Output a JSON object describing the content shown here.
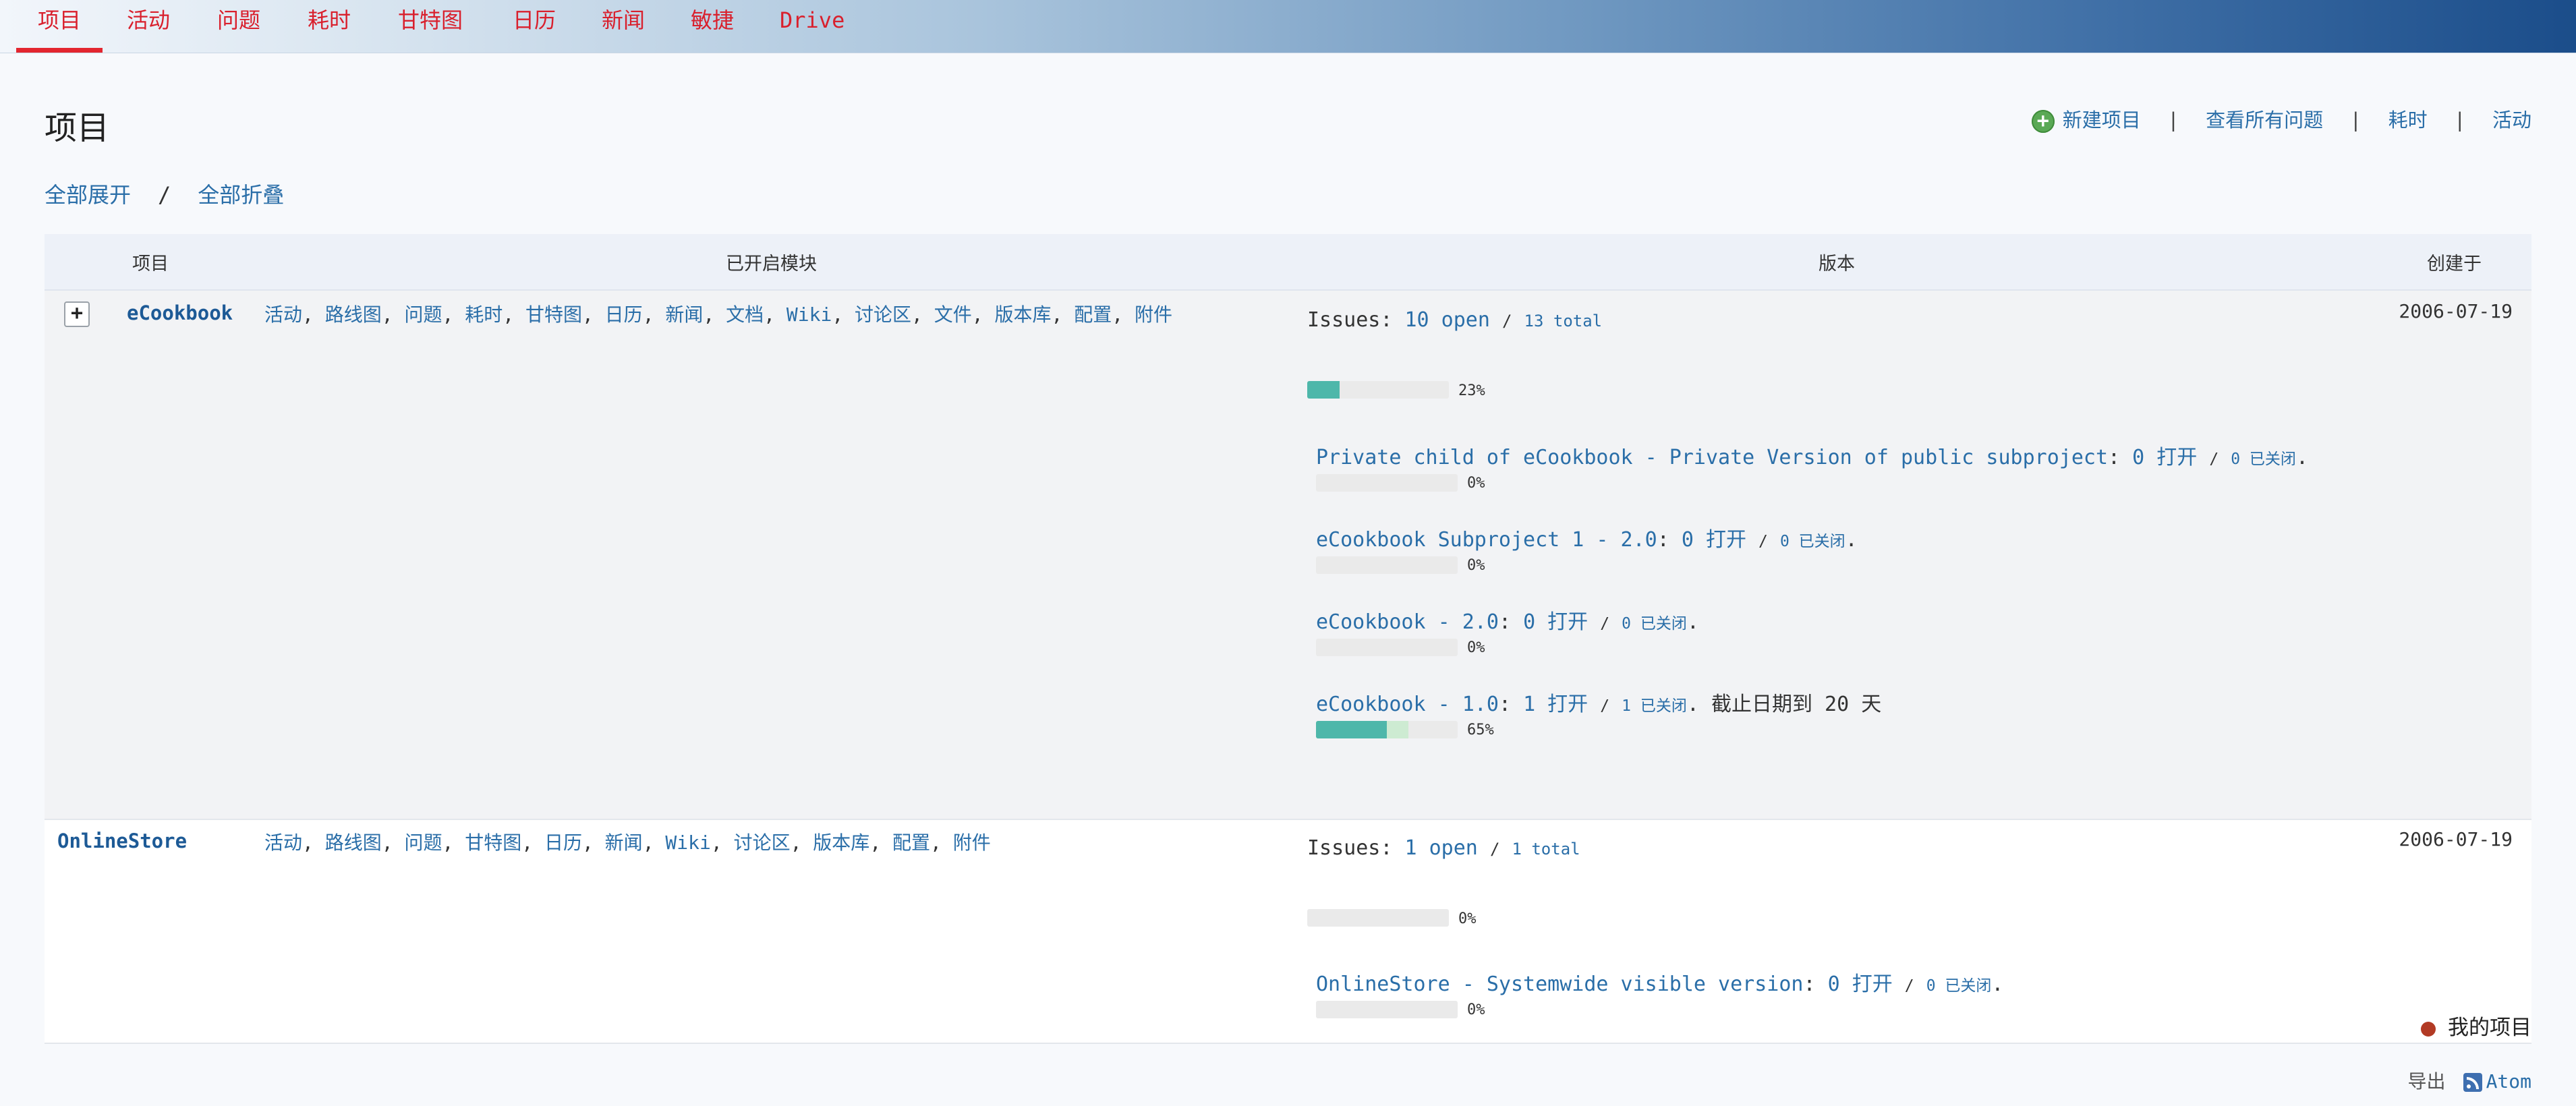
{
  "nav": {
    "tabs": [
      {
        "label": "项目",
        "active": true
      },
      {
        "label": "活动"
      },
      {
        "label": "问题"
      },
      {
        "label": "耗时"
      },
      {
        "label": "甘特图"
      },
      {
        "label": "日历"
      },
      {
        "label": "新闻"
      },
      {
        "label": "敏捷"
      },
      {
        "label": "Drive"
      }
    ],
    "accent_color": "#e3262f"
  },
  "page_title": "项目",
  "contextual": {
    "new_project": "新建项目",
    "view_all_issues": "查看所有问题",
    "time_entries": "耗时",
    "activity": "活动",
    "separator": "|"
  },
  "expand": {
    "expand_all": "全部展开",
    "slash": "/",
    "collapse_all": "全部折叠"
  },
  "table": {
    "headers": {
      "project": "项目",
      "modules": "已开启模块",
      "versions": "版本",
      "created": "创建于"
    },
    "rows": [
      {
        "expander": "+",
        "name": "eCookbook",
        "modules": [
          "活动",
          "路线图",
          "问题",
          "耗时",
          "甘特图",
          "日历",
          "新闻",
          "文档",
          "Wiki",
          "讨论区",
          "文件",
          "版本库",
          "配置",
          "附件"
        ],
        "created": "2006-07-19",
        "issues": {
          "label": "Issues:",
          "open": "10 open",
          "slash": "/",
          "total": "13 total",
          "percent": 23,
          "percent_label": "23%"
        },
        "versions": [
          {
            "name": "Private child of eCookbook - Private Version of public subproject",
            "open": "0 打开",
            "closed": "0 已关闭",
            "due": "",
            "percent": 0,
            "done": 0,
            "percent_label": "0%"
          },
          {
            "name": "eCookbook Subproject 1 - 2.0",
            "open": "0 打开",
            "closed": "0 已关闭",
            "due": "",
            "percent": 0,
            "done": 0,
            "percent_label": "0%"
          },
          {
            "name": "eCookbook - 2.0",
            "open": "0 打开",
            "closed": "0 已关闭",
            "due": "",
            "percent": 0,
            "done": 0,
            "percent_label": "0%"
          },
          {
            "name": "eCookbook - 1.0",
            "open": "1 打开",
            "closed": "1 已关闭",
            "due": "截止日期到 20 天",
            "percent": 50,
            "done": 65,
            "percent_label": "65%"
          }
        ]
      },
      {
        "name": "OnlineStore",
        "modules": [
          "活动",
          "路线图",
          "问题",
          "甘特图",
          "日历",
          "新闻",
          "Wiki",
          "讨论区",
          "版本库",
          "配置",
          "附件"
        ],
        "created": "2006-07-19",
        "issues": {
          "label": "Issues:",
          "open": "1 open",
          "slash": "/",
          "total": "1 total",
          "percent": 0,
          "percent_label": "0%"
        },
        "versions": [
          {
            "name": "OnlineStore - Systemwide visible version",
            "open": "0 打开",
            "closed": "0 已关闭",
            "due": "",
            "percent": 0,
            "done": 0,
            "percent_label": "0%"
          }
        ]
      }
    ]
  },
  "footer": {
    "my_projects": "我的项目",
    "export_label": "导出",
    "atom": "Atom"
  }
}
